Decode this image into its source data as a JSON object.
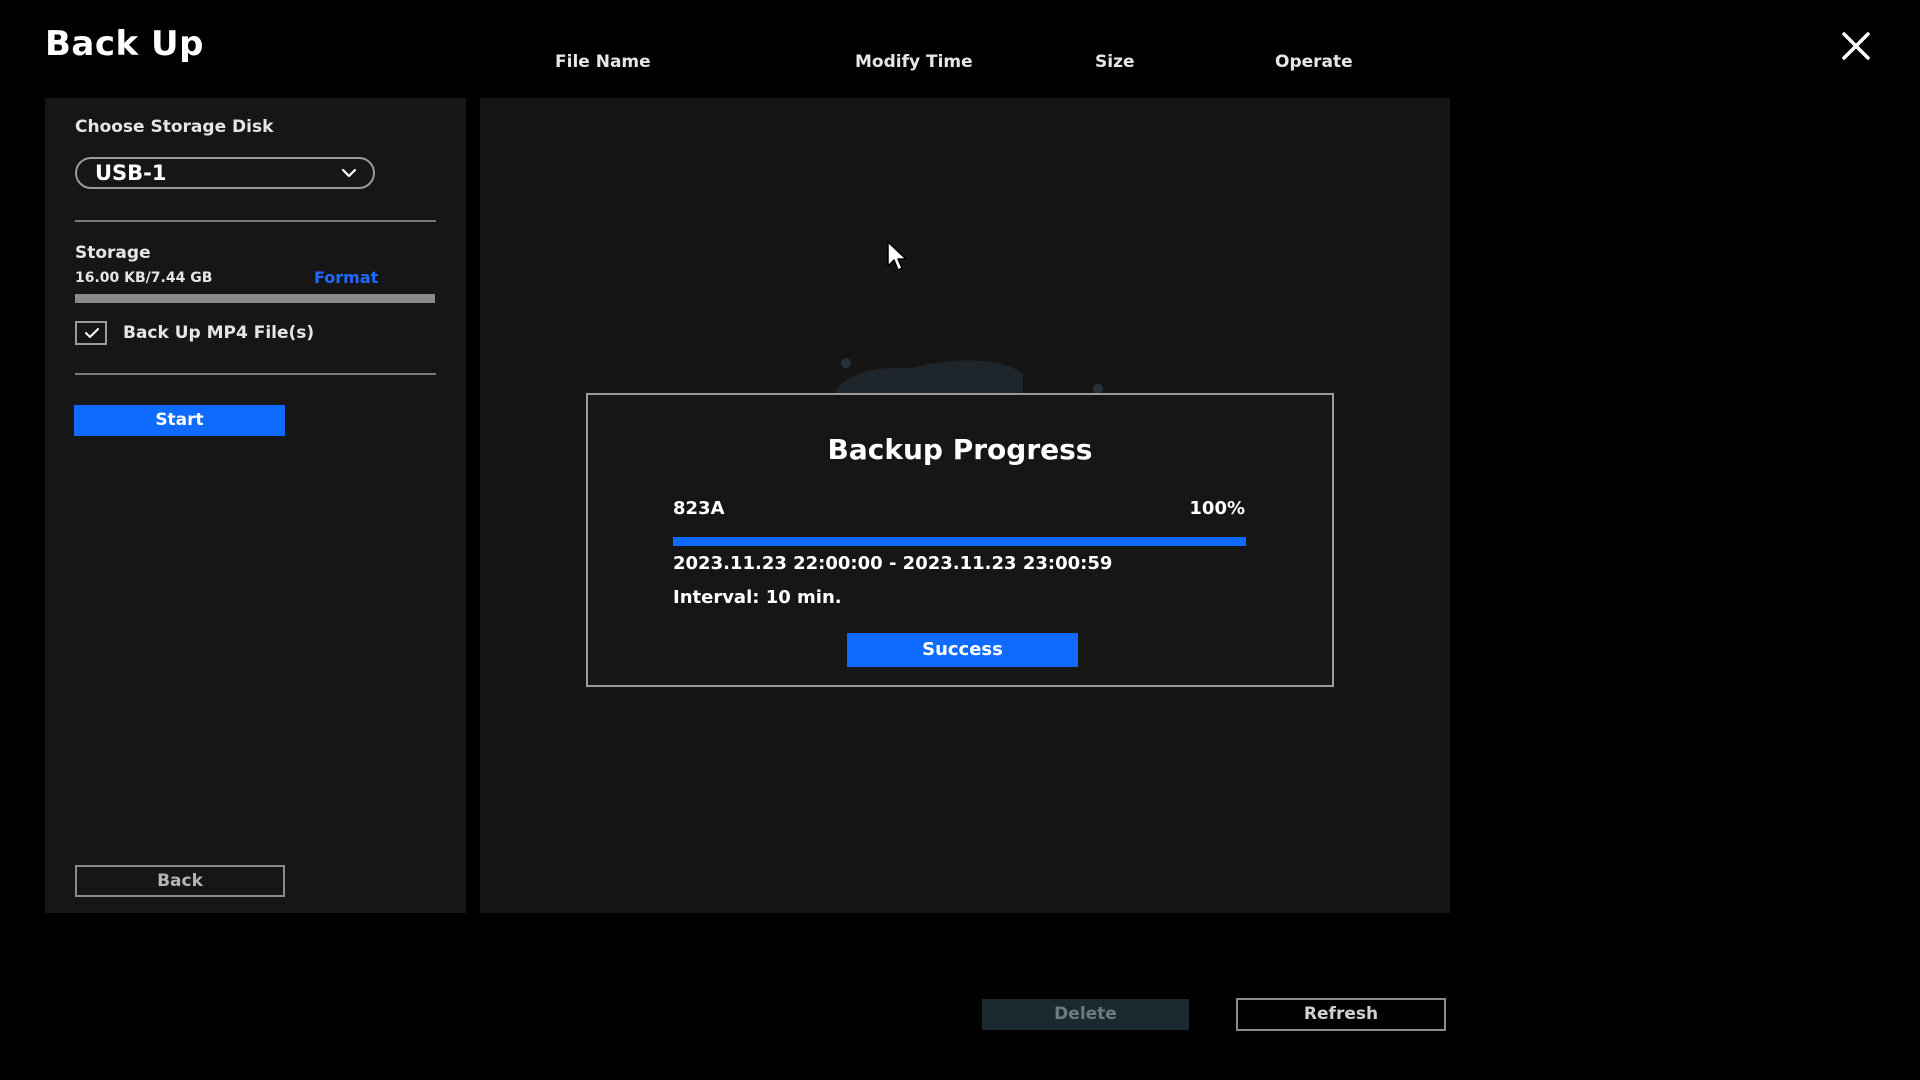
{
  "window": {
    "title": "Back Up",
    "close_icon": "close-icon"
  },
  "table": {
    "columns": [
      "File Name",
      "Modify Time",
      "Size",
      "Operate"
    ]
  },
  "sidebar": {
    "disk_label": "Choose Storage Disk",
    "disk_selected": "USB-1",
    "storage_label": "Storage",
    "storage_used": "16.00 KB/7.44 GB",
    "storage_fraction": 2e-06,
    "format_label": "Format",
    "mp4_checkbox_label": "Back Up MP4 File(s)",
    "mp4_checked": true,
    "start_label": "Start",
    "back_label": "Back"
  },
  "dialog": {
    "title": "Backup Progress",
    "camera": "823A",
    "percent_text": "100%",
    "progress": 1.0,
    "time_range": "2023.11.23 22:00:00 - 2023.11.23 23:00:59",
    "interval": "Interval: 10 min.",
    "button_label": "Success"
  },
  "footer": {
    "delete_label": "Delete",
    "refresh_label": "Refresh"
  },
  "colors": {
    "accent": "#0f6bff",
    "background": "#000000",
    "panel": "#161616",
    "disabled_button": "#1a2a30"
  }
}
